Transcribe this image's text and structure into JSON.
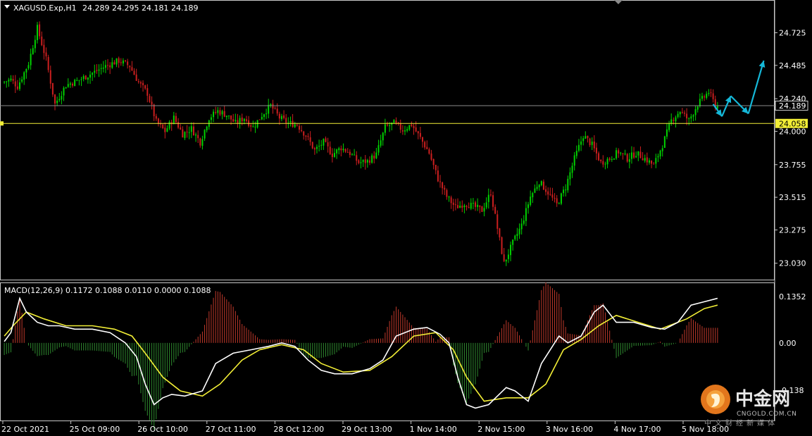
{
  "window": {
    "symbol_title": "XAGUSD.Exp,H1",
    "ohlc_text": "24.289 24.295 24.181 24.189",
    "dropdown_icon": "triangle-down-icon"
  },
  "price_axis": {
    "ticks": [
      "24.725",
      "24.485",
      "24.240",
      "24.000",
      "23.755",
      "23.515",
      "23.275",
      "23.030"
    ],
    "current_price_label": "24.189",
    "current_price": 24.189,
    "level_label": "24.058",
    "level_price": 24.058,
    "range": [
      22.925,
      24.945
    ]
  },
  "macd_panel": {
    "title": "MACD(12,26,9) 0.1172 0.1088 0.0110 0.0000 0.1088",
    "ticks": [
      "0.1352",
      "0.00",
      "-0.138"
    ],
    "range": [
      -0.22,
      0.17
    ]
  },
  "time_axis": {
    "labels": [
      "22 Oct 2021",
      "25 Oct 09:00",
      "26 Oct 10:00",
      "27 Oct 11:00",
      "28 Oct 12:00",
      "29 Oct 13:00",
      "1 Nov 14:00",
      "2 Nov 15:00",
      "3 Nov 16:00",
      "4 Nov 17:00",
      "5 Nov 18:00"
    ]
  },
  "watermark": {
    "name_cn": "中金网",
    "name_en": "CNGOLD.COM.CN",
    "tagline": "中文财经新媒体",
    "logo_icon": "cngold-logo-icon"
  },
  "colors": {
    "background": "#000000",
    "bull": "#00d100",
    "bear": "#cc1f1f",
    "level_line": "#f2ee36",
    "current_price_line": "#8c8c8c",
    "forecast_arrow": "#15b8d8",
    "macd_line": "#ffffff",
    "signal_line": "#f2ee36",
    "hist_pos": "#c0392b",
    "hist_neg": "#2f8a2f"
  },
  "chart_data": {
    "type": "candlestick",
    "timeframe": "H1",
    "price_path": [
      [
        0,
        24.36
      ],
      [
        4,
        24.38
      ],
      [
        7,
        24.33
      ],
      [
        12,
        24.5
      ],
      [
        16,
        24.76
      ],
      [
        20,
        24.53
      ],
      [
        24,
        24.2
      ],
      [
        29,
        24.34
      ],
      [
        34,
        24.37
      ],
      [
        40,
        24.42
      ],
      [
        47,
        24.48
      ],
      [
        53,
        24.52
      ],
      [
        58,
        24.48
      ],
      [
        62,
        24.36
      ],
      [
        66,
        24.28
      ],
      [
        70,
        24.07
      ],
      [
        74,
        24.0
      ],
      [
        78,
        24.1
      ],
      [
        82,
        23.98
      ],
      [
        86,
        24.02
      ],
      [
        90,
        23.92
      ],
      [
        94,
        24.1
      ],
      [
        98,
        24.15
      ],
      [
        102,
        24.12
      ],
      [
        106,
        24.06
      ],
      [
        110,
        24.1
      ],
      [
        114,
        24.03
      ],
      [
        118,
        24.12
      ],
      [
        122,
        24.19
      ],
      [
        126,
        24.1
      ],
      [
        130,
        24.06
      ],
      [
        134,
        24.05
      ],
      [
        138,
        23.97
      ],
      [
        142,
        23.86
      ],
      [
        146,
        23.92
      ],
      [
        150,
        23.83
      ],
      [
        154,
        23.88
      ],
      [
        158,
        23.84
      ],
      [
        162,
        23.77
      ],
      [
        166,
        23.78
      ],
      [
        170,
        23.83
      ],
      [
        174,
        24.03
      ],
      [
        178,
        24.06
      ],
      [
        182,
        24.01
      ],
      [
        186,
        24.05
      ],
      [
        190,
        23.95
      ],
      [
        194,
        23.84
      ],
      [
        198,
        23.65
      ],
      [
        202,
        23.52
      ],
      [
        206,
        23.44
      ],
      [
        210,
        23.47
      ],
      [
        214,
        23.45
      ],
      [
        218,
        23.42
      ],
      [
        222,
        23.55
      ],
      [
        226,
        23.2
      ],
      [
        228,
        23.03
      ],
      [
        232,
        23.18
      ],
      [
        236,
        23.31
      ],
      [
        240,
        23.52
      ],
      [
        244,
        23.63
      ],
      [
        248,
        23.55
      ],
      [
        252,
        23.46
      ],
      [
        256,
        23.59
      ],
      [
        260,
        23.8
      ],
      [
        264,
        23.97
      ],
      [
        268,
        23.9
      ],
      [
        272,
        23.77
      ],
      [
        276,
        23.8
      ],
      [
        280,
        23.85
      ],
      [
        284,
        23.8
      ],
      [
        288,
        23.84
      ],
      [
        292,
        23.8
      ],
      [
        296,
        23.75
      ],
      [
        300,
        23.9
      ],
      [
        304,
        24.08
      ],
      [
        308,
        24.15
      ],
      [
        312,
        24.08
      ],
      [
        316,
        24.2
      ],
      [
        321,
        24.29
      ],
      [
        324,
        24.19
      ]
    ],
    "macd_path": [
      [
        0,
        0.004
      ],
      [
        3,
        0.03
      ],
      [
        7,
        0.13
      ],
      [
        10,
        0.09
      ],
      [
        15,
        0.06
      ],
      [
        20,
        0.05
      ],
      [
        25,
        0.05
      ],
      [
        32,
        0.04
      ],
      [
        40,
        0.04
      ],
      [
        48,
        0.03
      ],
      [
        55,
        0.0
      ],
      [
        60,
        -0.04
      ],
      [
        64,
        -0.12
      ],
      [
        68,
        -0.18
      ],
      [
        72,
        -0.16
      ],
      [
        76,
        -0.15
      ],
      [
        82,
        -0.155
      ],
      [
        90,
        -0.14
      ],
      [
        96,
        -0.06
      ],
      [
        104,
        -0.03
      ],
      [
        112,
        -0.02
      ],
      [
        120,
        -0.01
      ],
      [
        126,
        0.0
      ],
      [
        132,
        -0.01
      ],
      [
        138,
        -0.05
      ],
      [
        144,
        -0.08
      ],
      [
        150,
        -0.09
      ],
      [
        158,
        -0.09
      ],
      [
        166,
        -0.075
      ],
      [
        172,
        -0.05
      ],
      [
        178,
        0.02
      ],
      [
        186,
        0.04
      ],
      [
        192,
        0.045
      ],
      [
        198,
        0.025
      ],
      [
        202,
        0.0
      ],
      [
        206,
        -0.1
      ],
      [
        210,
        -0.18
      ],
      [
        214,
        -0.19
      ],
      [
        220,
        -0.18
      ],
      [
        228,
        -0.13
      ],
      [
        232,
        -0.14
      ],
      [
        238,
        -0.17
      ],
      [
        244,
        -0.06
      ],
      [
        252,
        0.02
      ],
      [
        256,
        0.0
      ],
      [
        262,
        0.02
      ],
      [
        268,
        0.09
      ],
      [
        272,
        0.11
      ],
      [
        278,
        0.06
      ],
      [
        286,
        0.06
      ],
      [
        294,
        0.045
      ],
      [
        300,
        0.04
      ],
      [
        306,
        0.06
      ],
      [
        312,
        0.11
      ],
      [
        318,
        0.12
      ],
      [
        324,
        0.13
      ]
    ],
    "signal_path": [
      [
        0,
        0.02
      ],
      [
        4,
        0.05
      ],
      [
        10,
        0.09
      ],
      [
        18,
        0.07
      ],
      [
        28,
        0.05
      ],
      [
        40,
        0.05
      ],
      [
        50,
        0.04
      ],
      [
        58,
        0.02
      ],
      [
        64,
        -0.03
      ],
      [
        72,
        -0.1
      ],
      [
        80,
        -0.14
      ],
      [
        90,
        -0.155
      ],
      [
        98,
        -0.12
      ],
      [
        108,
        -0.05
      ],
      [
        116,
        -0.02
      ],
      [
        126,
        -0.005
      ],
      [
        136,
        -0.02
      ],
      [
        144,
        -0.06
      ],
      [
        154,
        -0.085
      ],
      [
        166,
        -0.08
      ],
      [
        176,
        -0.04
      ],
      [
        186,
        0.02
      ],
      [
        196,
        0.03
      ],
      [
        204,
        -0.02
      ],
      [
        210,
        -0.1
      ],
      [
        218,
        -0.17
      ],
      [
        228,
        -0.16
      ],
      [
        238,
        -0.16
      ],
      [
        246,
        -0.12
      ],
      [
        254,
        -0.02
      ],
      [
        262,
        0.01
      ],
      [
        270,
        0.05
      ],
      [
        278,
        0.08
      ],
      [
        288,
        0.06
      ],
      [
        298,
        0.04
      ],
      [
        310,
        0.07
      ],
      [
        318,
        0.1
      ],
      [
        324,
        0.11
      ]
    ],
    "forecast_arrows": [
      [
        [
          323,
          24.2
        ],
        [
          327,
          24.11
        ]
      ],
      [
        [
          327,
          24.11
        ],
        [
          331,
          24.26
        ]
      ],
      [
        [
          331,
          24.26
        ],
        [
          339,
          24.13
        ]
      ],
      [
        [
          339,
          24.13
        ],
        [
          346,
          24.52
        ]
      ]
    ]
  }
}
